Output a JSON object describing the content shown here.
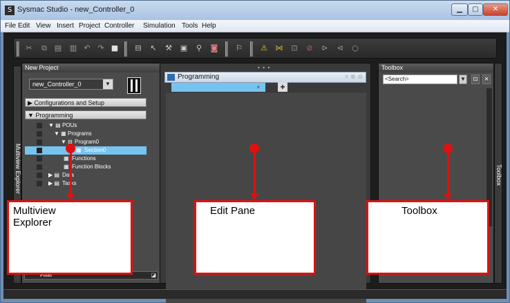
{
  "window": {
    "title": "Sysmac Studio - new_Controller_0",
    "app_icon_glyph": "S"
  },
  "menu": [
    "File",
    "Edit",
    "View",
    "Insert",
    "Project",
    "Controller",
    "Simulation",
    "Tools",
    "Help"
  ],
  "toolbar": {
    "icons": [
      "cut-icon",
      "copy-icon",
      "paste-icon",
      "delete-icon",
      "undo-icon",
      "redo-icon",
      "save-icon",
      "build-icon",
      "cross-reference-icon",
      "wrench-icon",
      "compare-icon",
      "search-icon",
      "stop-icon",
      "simulate-icon",
      "warning-icon",
      "variable-icon",
      "rung-icon",
      "coil-icon",
      "contact-icon",
      "online-icon",
      "circle-icon"
    ]
  },
  "explorer": {
    "header": "New Project",
    "controller": "new_Controller_0",
    "sections": {
      "config": "Configurations and Setup",
      "programming": "Programming"
    },
    "tree": [
      "POUs",
      "Programs",
      "Program0",
      "Section0",
      "Functions",
      "Function Blocks",
      "Data",
      "Tasks"
    ],
    "side_label": "Multiview Explorer",
    "filter_label": "Filter"
  },
  "edit": {
    "title": "Programming",
    "grip": "• • •",
    "tools": "⌗ ⊕ ⊖",
    "tab_close": "×",
    "add_tab": "+"
  },
  "toolbox": {
    "header": "Toolbox",
    "search_placeholder": "<Search>",
    "side_label": "Toolbox"
  },
  "annotations": {
    "explorer": [
      "Multiview",
      "Explorer"
    ],
    "edit_pane": "Edit Pane",
    "toolbox": "Toolbox"
  },
  "colors": {
    "accent_red": "#e01010",
    "selection_blue": "#76c3ef"
  }
}
